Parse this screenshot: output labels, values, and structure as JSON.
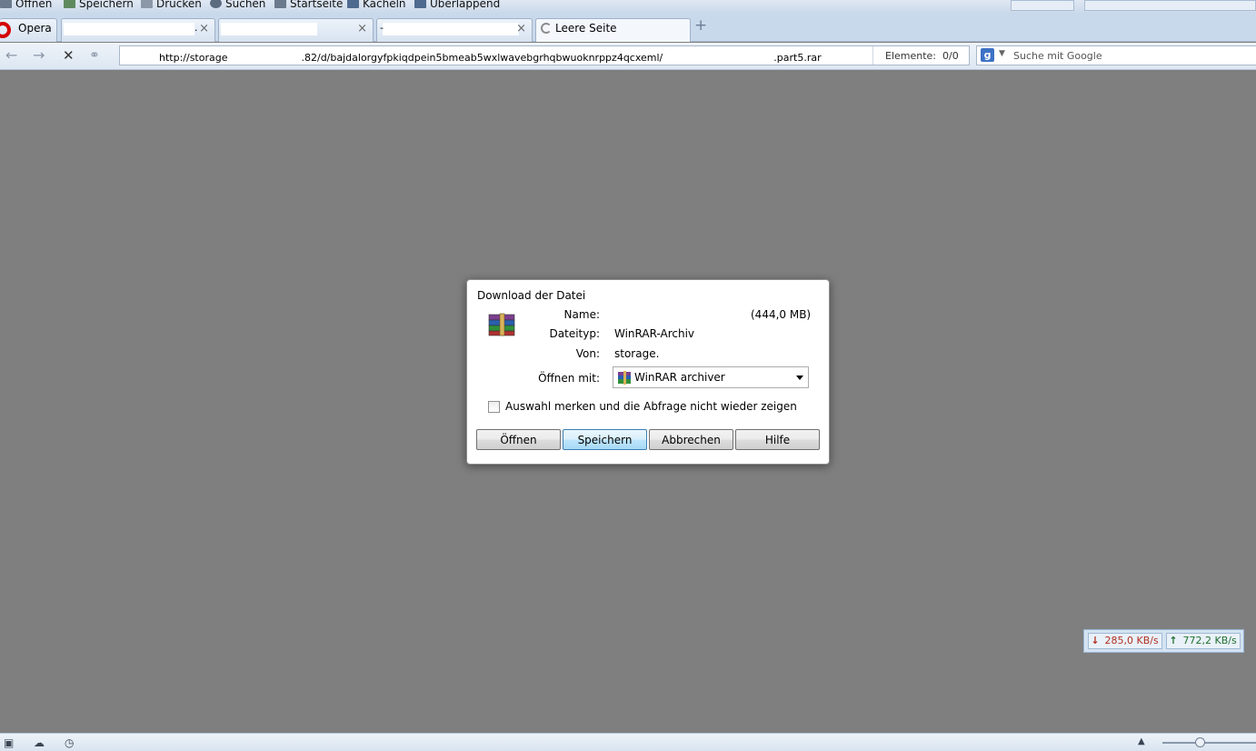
{
  "menubar": {
    "items": [
      {
        "label": "Öffnen",
        "icon": "folder-icon"
      },
      {
        "label": "Speichern",
        "icon": "save-icon"
      },
      {
        "label": "Drucken",
        "icon": "printer-icon"
      },
      {
        "label": "Suchen",
        "icon": "search-icon"
      },
      {
        "label": "Startseite",
        "icon": "home-icon"
      },
      {
        "label": "Kacheln",
        "icon": "tile-icon"
      },
      {
        "label": "Überlappend",
        "icon": "cascade-icon"
      }
    ]
  },
  "tabs": {
    "opera_label": "Opera",
    "tab1_suffix": ".",
    "tab3_suffix": "-",
    "active_label": "Leere Seite",
    "close_glyph": "×",
    "new_tab_glyph": "+"
  },
  "address": {
    "url_start": "http://storage",
    "url_mid": ".82/d/bajdalorgyfpkiqdpein5bmeab5wxlwavebgrhqbwuoknrppz4qcxeml/",
    "url_end": ".part5.rar",
    "elements_label": "Elemente:",
    "elements_count": "0/0",
    "search_placeholder": "Suche mit Google"
  },
  "dialog": {
    "title": "Download der Datei",
    "name_label": "Name:",
    "size": "(444,0 MB)",
    "type_label": "Dateityp:",
    "type_value": "WinRAR-Archiv",
    "from_label": "Von:",
    "from_value": "storage.",
    "openwith_label": "Öffnen mit:",
    "openwith_value": "WinRAR archiver",
    "remember_label": "Auswahl merken und die Abfrage nicht wieder zeigen",
    "buttons": {
      "open": "Öffnen",
      "save": "Speichern",
      "cancel": "Abbrechen",
      "help": "Hilfe"
    }
  },
  "transfer": {
    "download": "285,0 KB/s",
    "upload": "772,2 KB/s"
  }
}
